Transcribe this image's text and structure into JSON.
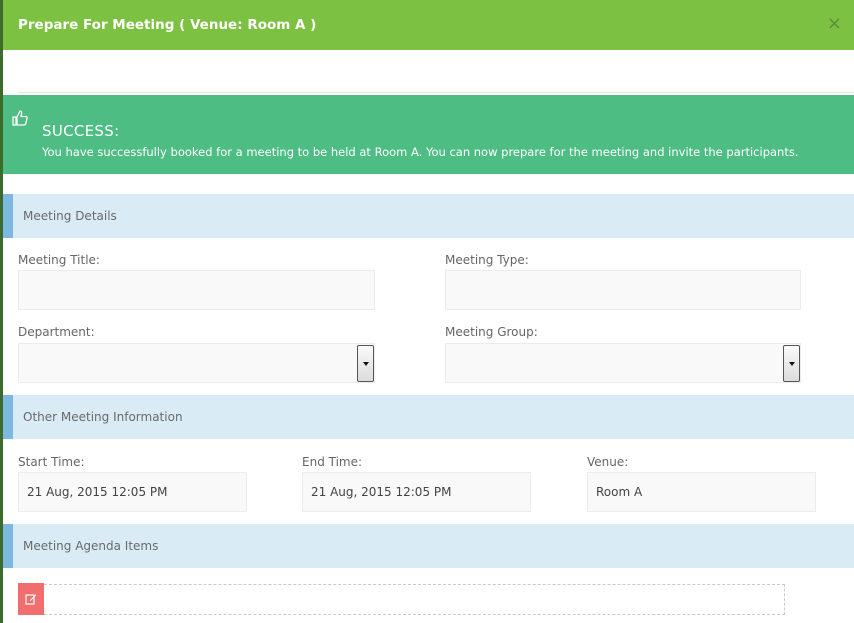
{
  "modal": {
    "title": "Prepare For Meeting ( Venue: Room A )",
    "close_label": "×"
  },
  "alert": {
    "icon": "thumbs-up-icon",
    "title": "SUCCESS:",
    "message": "You have successfully booked for a meeting to be held at Room A. You can now prepare for the meeting and invite the participants."
  },
  "sections": {
    "details": "Meeting Details",
    "other": "Other Meeting Information",
    "agenda": "Meeting Agenda Items"
  },
  "fields": {
    "meeting_title": {
      "label": "Meeting Title:",
      "value": ""
    },
    "meeting_type": {
      "label": "Meeting Type:",
      "value": ""
    },
    "department": {
      "label": "Department:",
      "value": ""
    },
    "meeting_group": {
      "label": "Meeting Group:",
      "value": ""
    },
    "start_time": {
      "label": "Start Time:",
      "value": "21 Aug, 2015 12:05 PM"
    },
    "end_time": {
      "label": "End Time:",
      "value": "21 Aug, 2015 12:05 PM"
    },
    "venue": {
      "label": "Venue:",
      "value": "Room A"
    }
  },
  "agenda": {
    "edit_icon": "edit-icon"
  },
  "colors": {
    "header": "#7dc143",
    "success": "#4dbd84",
    "section_bg": "#d9ebf5",
    "section_accent": "#7db9de",
    "edit_button": "#f26d6d"
  }
}
